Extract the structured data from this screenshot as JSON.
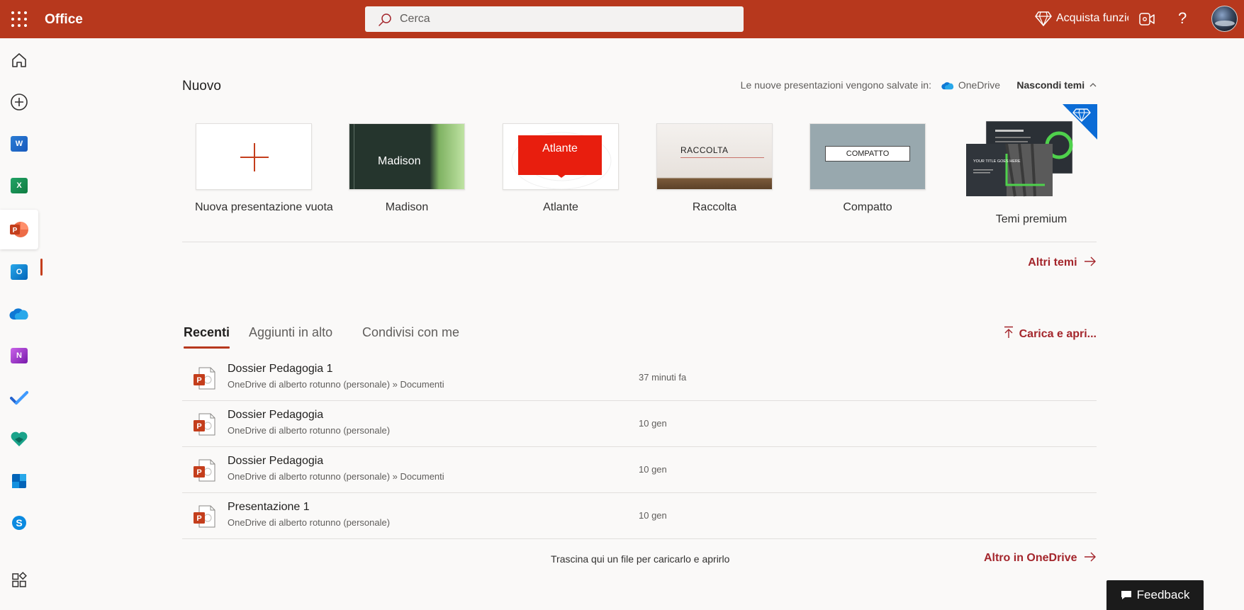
{
  "app": {
    "title": "Office"
  },
  "header": {
    "search_placeholder": "Cerca",
    "premium_label": "Acquista funzionalità Premium",
    "help_label": "?"
  },
  "rail": {
    "items": [
      {
        "name": "home-icon"
      },
      {
        "name": "create-icon"
      },
      {
        "name": "word-icon",
        "letter": "W",
        "color": "#185abd"
      },
      {
        "name": "excel-icon",
        "letter": "X",
        "color": "#107c41"
      },
      {
        "name": "powerpoint-icon",
        "letter": "P",
        "color": "#c43e1c",
        "active": true
      },
      {
        "name": "outlook-icon",
        "letter": "O",
        "color": "#0078d4"
      },
      {
        "name": "onedrive-icon"
      },
      {
        "name": "onenote-icon",
        "letter": "N",
        "color": "#7719aa"
      },
      {
        "name": "todo-icon"
      },
      {
        "name": "family-safety-icon"
      },
      {
        "name": "sway-icon"
      },
      {
        "name": "skype-icon",
        "letter": "S",
        "color": "#0078d4"
      },
      {
        "name": "all-apps-icon"
      }
    ]
  },
  "new_section": {
    "title": "Nuovo",
    "save_info": "Le nuove presentazioni vengono salvate in:",
    "save_location": "OneDrive",
    "hide_themes": "Nascondi temi",
    "templates": [
      {
        "name": "Nuova presentazione vuota",
        "thumb_text": ""
      },
      {
        "name": "Madison",
        "thumb_text": "Madison"
      },
      {
        "name": "Atlante",
        "thumb_text": "Atlante"
      },
      {
        "name": "Raccolta",
        "thumb_text": "RACCOLTA"
      },
      {
        "name": "Compatto",
        "thumb_text": "COMPATTO"
      }
    ],
    "premium": {
      "name": "Temi premium",
      "slide_text_1": "YOUR TITLE GOES HERE",
      "slide_text_2": "YOUR TITLE GOES HERE"
    },
    "more_themes": "Altri temi"
  },
  "recent_section": {
    "tabs": [
      "Recenti",
      "Aggiunti in alto",
      "Condivisi con me"
    ],
    "active_tab": 0,
    "upload": "Carica e apri...",
    "files": [
      {
        "name": "Dossier Pedagogia 1",
        "path": "OneDrive di alberto rotunno (personale) » Documenti",
        "date": "37 minuti fa"
      },
      {
        "name": "Dossier Pedagogia",
        "path": "OneDrive di alberto rotunno (personale)",
        "date": "10 gen"
      },
      {
        "name": "Dossier Pedagogia",
        "path": "OneDrive di alberto rotunno (personale) » Documenti",
        "date": "10 gen"
      },
      {
        "name": "Presentazione 1",
        "path": "OneDrive di alberto rotunno (personale)",
        "date": "10 gen"
      }
    ],
    "drop_hint": "Trascina qui un file per caricarlo e aprirlo",
    "more_onedrive": "Altro in OneDrive"
  },
  "feedback": {
    "label": "Feedback"
  },
  "colors": {
    "brand": "#b7381d",
    "accent_text": "#a4262c",
    "powerpoint": "#c43e1c"
  }
}
